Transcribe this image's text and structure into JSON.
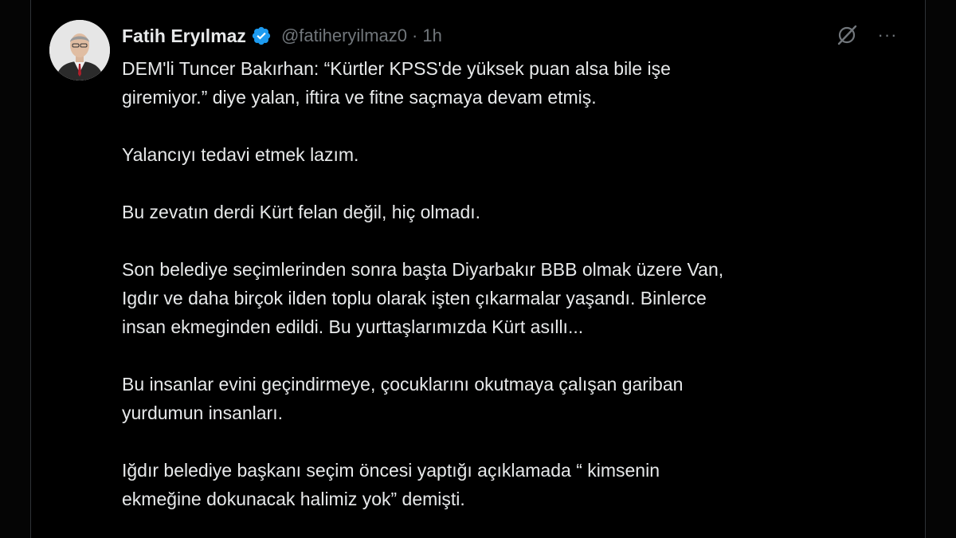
{
  "tweet": {
    "author": {
      "display_name": "Fatih Eryılmaz",
      "handle": "@fatiheryilmaz0",
      "verified": true,
      "verified_icon": "verified-badge-icon",
      "avatar_icon": "profile-avatar"
    },
    "separator": "·",
    "time": "1h",
    "actions": {
      "grok_icon": "grok-icon",
      "more_icon": "more-options-icon",
      "more_label": "···"
    },
    "body": {
      "paragraphs": [
        [
          "DEM'li Tuncer Bakırhan: “Kürtler KPSS'de yüksek puan alsa bile işe",
          "giremiyor.” diye yalan, iftira ve fitne saçmaya devam etmiş."
        ],
        [
          "Yalancıyı tedavi etmek lazım."
        ],
        [
          "Bu zevatın derdi Kürt felan değil, hiç olmadı."
        ],
        [
          "Son belediye seçimlerinden sonra başta Diyarbakır BBB olmak üzere Van,",
          "Igdır ve daha birçok ilden toplu olarak işten çıkarmalar yaşandı.  Binlerce",
          "insan ekmeginden edildi. Bu yurttaşlarımızda Kürt asıllı..."
        ],
        [
          "Bu insanlar evini geçindirmeye, çocuklarını okutmaya çalışan gariban",
          "yurdumun insanları."
        ],
        [
          "Iğdır belediye başkanı seçim öncesi yaptığı açıklamada “ kimsenin",
          "ekmeğine dokunacak halimiz yok” demişti."
        ]
      ]
    }
  },
  "colors": {
    "background": "#000000",
    "text_primary": "#e7e9ea",
    "text_secondary": "#71767b",
    "verified_blue": "#1d9bf0",
    "border": "#2f3336"
  }
}
